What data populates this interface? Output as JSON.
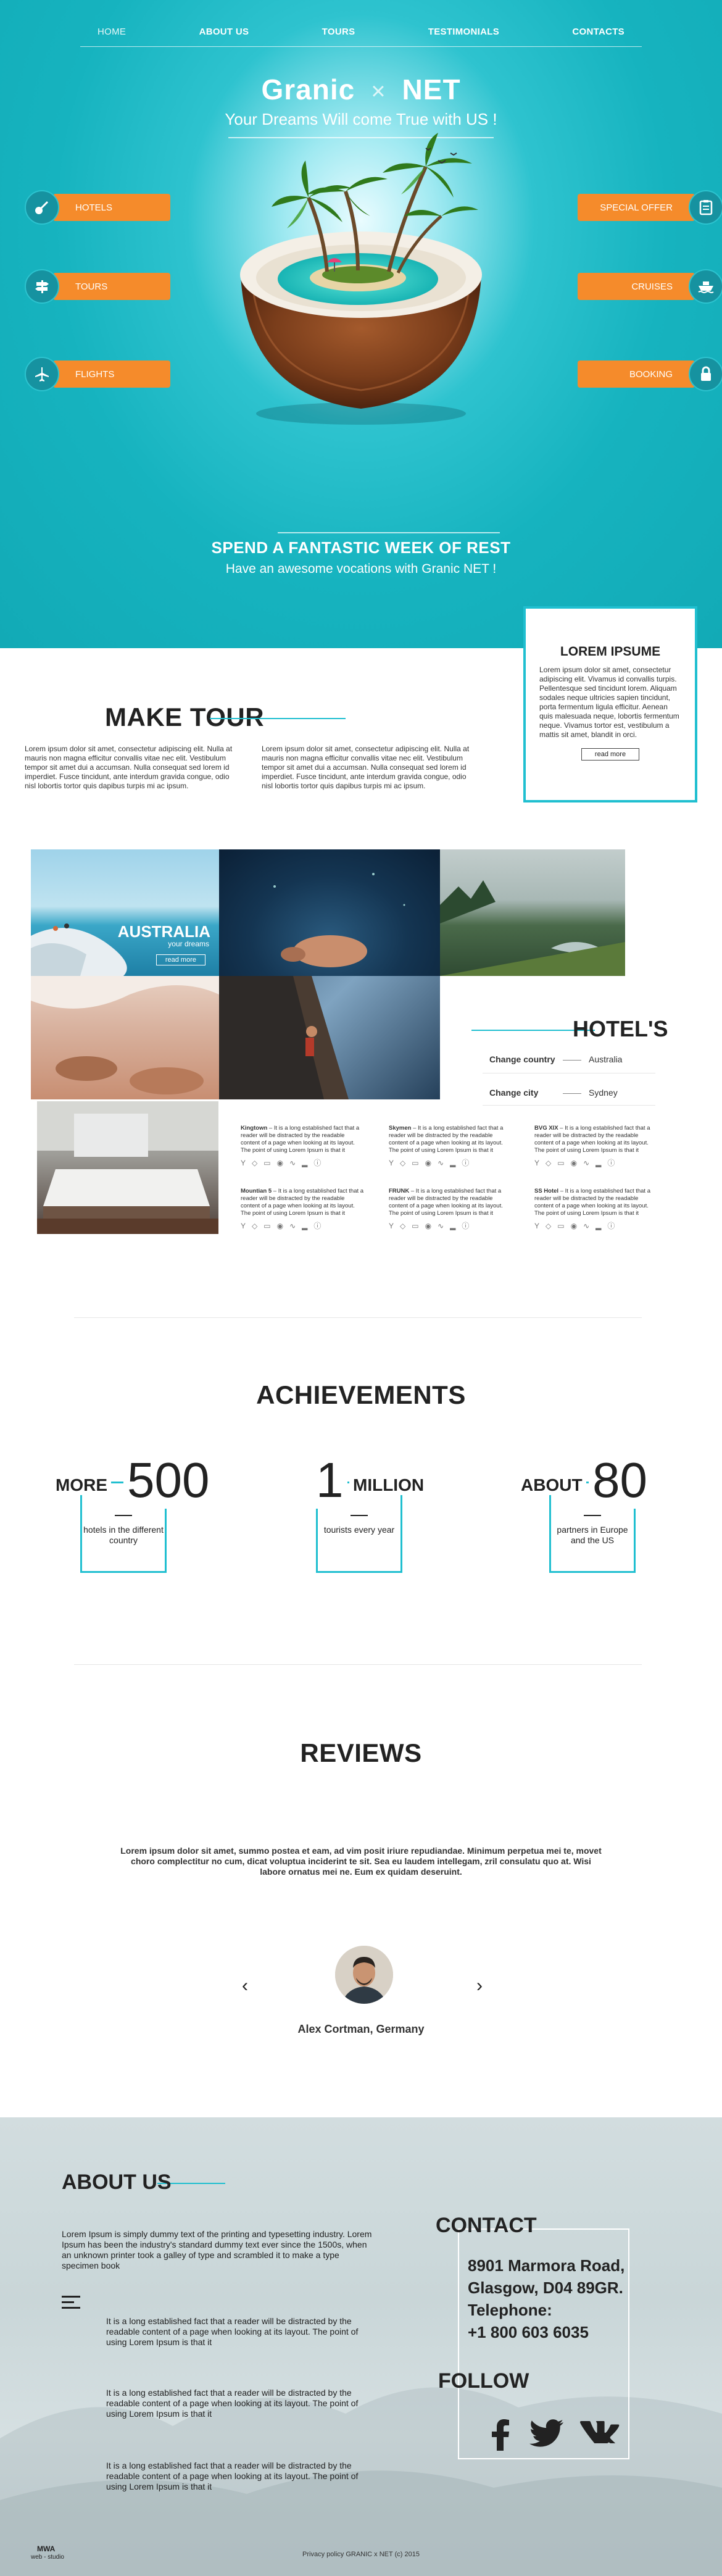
{
  "nav": [
    "HOME",
    "ABOUT US",
    "TOURS",
    "TESTIMONIALS",
    "CONTACTS"
  ],
  "brand": {
    "left": "Granic",
    "sep": "×",
    "right": "NET"
  },
  "tagline": "Your Dreams Will come True with US !",
  "side_left": [
    {
      "label": "HOTELS",
      "icon": "guitar-icon"
    },
    {
      "label": "TOURS",
      "icon": "signpost-icon"
    },
    {
      "label": "FLIGHTS",
      "icon": "airplane-icon"
    }
  ],
  "side_right": [
    {
      "label": "SPECIAL OFFER",
      "icon": "clipboard-icon"
    },
    {
      "label": "CRUISES",
      "icon": "ship-icon"
    },
    {
      "label": "BOOKING",
      "icon": "lock-icon"
    }
  ],
  "hero": {
    "title": "SPEND A FANTASTIC WEEK OF REST",
    "subtitle": "Have an awesome vocations with Granic NET !"
  },
  "lorem_box": {
    "title": "LOREM IPSUME",
    "text": "Lorem ipsum dolor sit amet, consectetur adipiscing elit. Vivamus id convallis turpis. Pellentesque sed tincidunt lorem. Aliquam sodales neque ultricies sapien tincidunt, porta fermentum ligula efficitur. Aenean quis malesuada neque, lobortis fermentum neque. Vivamus tortor est, vestibulum a mattis sit amet, blandit in orci.",
    "button": "read more"
  },
  "make_tour": {
    "title": "MAKE TOUR",
    "col1": "Lorem ipsum dolor sit amet, consectetur adipiscing elit. Nulla at mauris non magna efficitur convallis vitae nec elit. Vestibulum tempor sit amet dui a accumsan. Nulla consequat sed lorem id imperdiet. Fusce tincidunt, ante interdum gravida congue, odio nisl lobortis tortor quis dapibus turpis mi ac ipsum.",
    "col2": "Lorem ipsum dolor sit amet, consectetur adipiscing elit. Nulla at mauris non magna efficitur convallis vitae nec elit. Vestibulum tempor sit amet dui a accumsan. Nulla consequat sed lorem id imperdiet. Fusce tincidunt, ante interdum gravida congue, odio nisl lobortis tortor quis dapibus turpis mi ac ipsum."
  },
  "gallery": {
    "feature_title": "AUSTRALIA",
    "feature_sub": "your dreams",
    "feature_button": "read more"
  },
  "hotels": {
    "title": "HOTEL'S",
    "country_label": "Change country",
    "country_value": "Australia",
    "city_label": "Change city",
    "city_value": "Sydney",
    "cards": [
      {
        "name": "Kingtown",
        "text": " – It is a long established fact that a reader will be distracted by the readable content of a page when looking at its layout. The point of using Lorem Ipsum is that it"
      },
      {
        "name": "Skymen",
        "text": " – It is a long established fact that a reader will be distracted by the readable content of a page when looking at its layout. The point of using Lorem Ipsum is that it"
      },
      {
        "name": "BVG XIX",
        "text": " – It is a long established fact that a reader will be distracted by the readable content of a page when looking at its layout. The point of using Lorem Ipsum is that it"
      },
      {
        "name": "Mountian 5",
        "text": " – It is a long established fact that a reader will be distracted by the readable content of a page when looking at its layout. The point of using Lorem Ipsum is that it"
      },
      {
        "name": "FRUNK",
        "text": " – It is a long established fact that a reader will be distracted by the readable content of a page when looking at its layout. The point of using Lorem Ipsum is that it"
      },
      {
        "name": "SS Hotel",
        "text": " – It is a long established fact that a reader will be distracted by the readable content of a page when looking at its layout. The point of using Lorem Ipsum is that it"
      }
    ],
    "amenity_icons": [
      "cocktail-icon",
      "tag-icon",
      "car-icon",
      "pin-icon",
      "pool-icon",
      "bed-icon",
      "info-icon"
    ]
  },
  "achievements": {
    "title": "ACHIEVEMENTS",
    "stats": [
      {
        "prefix": "MORE",
        "number": "500",
        "suffix": "",
        "desc": "hotels in the different country"
      },
      {
        "prefix": "",
        "number": "1",
        "suffix": "MILLION",
        "desc": "tourists every year"
      },
      {
        "prefix": "ABOUT",
        "number": "80",
        "suffix": "",
        "desc": "partners in Europe and the US"
      }
    ]
  },
  "reviews": {
    "title": "REVIEWS",
    "text": "Lorem ipsum dolor sit amet, summo postea et eam, ad vim posit iriure repudiandae. Minimum perpetua mei te, movet choro complectitur no cum, dicat voluptua inciderint te sit. Sea eu laudem intellegam, zril consulatu quo at. Wisi labore ornatus mei ne. Eum ex quidam deseruint.",
    "prev": "‹",
    "next": "›",
    "name": "Alex Cortman, Germany"
  },
  "about": {
    "title": "ABOUT US",
    "text": "Lorem Ipsum is simply dummy text of the printing and typesetting industry. Lorem Ipsum has been the industry's standard dummy text ever since the 1500s, when an unknown printer took a galley of type and scrambled it to make a type specimen book",
    "items": [
      "It is a long established fact that a reader will be distracted by the readable content of a page when looking at its layout. The point of using Lorem Ipsum is that it",
      "It is a long established fact that a reader will be distracted by the readable content of a page when looking at its layout. The point of using Lorem Ipsum is that it",
      "It is a long established fact that a reader will be distracted by the readable content of a page when looking at its layout. The point of using Lorem Ipsum is that it"
    ]
  },
  "contact": {
    "title": "CONTACT",
    "address1": "8901 Marmora Road,",
    "address2": "Glasgow, D04 89GR.",
    "phone_label": "Telephone:",
    "phone": "+1 800 603 6035",
    "follow": "FOLLOW",
    "social": [
      {
        "label": "f",
        "icon": "facebook-icon"
      },
      {
        "label": "twitter",
        "icon": "twitter-icon"
      },
      {
        "label": "vk",
        "icon": "vk-icon"
      }
    ]
  },
  "footer": {
    "brand": "MWA",
    "brand_sub": "web - studio",
    "copyright": "Privacy policy  GRANIC x NET (c) 2015"
  },
  "colors": {
    "accent": "#20bfd0",
    "orange": "#f58b2b",
    "hero": "#16b3bf"
  }
}
